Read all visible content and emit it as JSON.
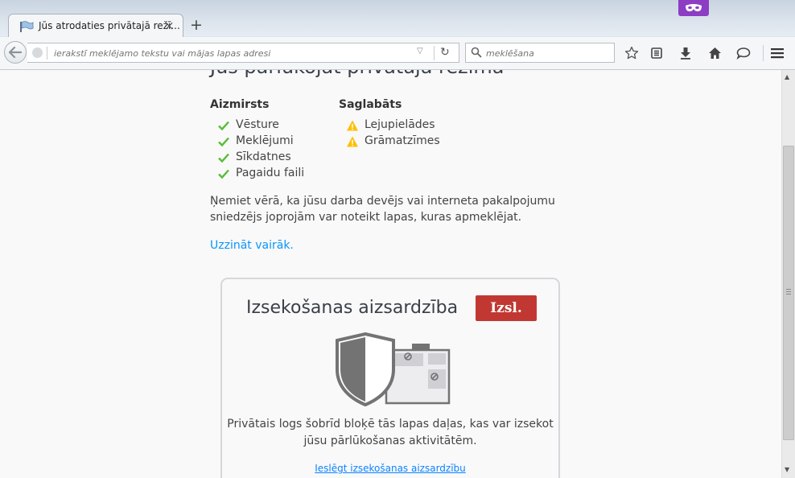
{
  "tab": {
    "title": "Jūs atrodaties privātajā režī...",
    "close": "×"
  },
  "newtab": "+",
  "urlbar": {
    "placeholder": "ierakstī meklējamo tekstu vai mājas lapas adresi"
  },
  "searchbar": {
    "placeholder": "meklēšana"
  },
  "page": {
    "heading": "Jūs pārlūkojat privātajā režīmā",
    "forgotten": {
      "title": "Aizmirsts",
      "items": [
        "Vēsture",
        "Meklējumi",
        "Sīkdatnes",
        "Pagaidu faili"
      ]
    },
    "saved": {
      "title": "Saglabāts",
      "items": [
        "Lejupielādes",
        "Grāmatzīmes"
      ]
    },
    "note": "Ņemiet vērā, ka jūsu darba devējs vai interneta pakalpojumu sniedzējs joprojām var noteikt lapas, kuras apmeklējat.",
    "learn_more": "Uzzināt vairāk.",
    "tracking": {
      "title": "Izsekošanas aizsardzība",
      "toggle_label": "Izsl.",
      "description": "Privātais logs šobrīd bloķē tās lapas daļas, kas var izsekot jūsu pārlūkošanas aktivitātēm.",
      "enable_link": "Ieslēgt izsekošanas aizsardzību"
    }
  },
  "colors": {
    "check": "#57bd35",
    "warning": "#ffbf00",
    "toggle": "#c13832",
    "link": "#0996f8",
    "private": "#8d3cc4"
  }
}
